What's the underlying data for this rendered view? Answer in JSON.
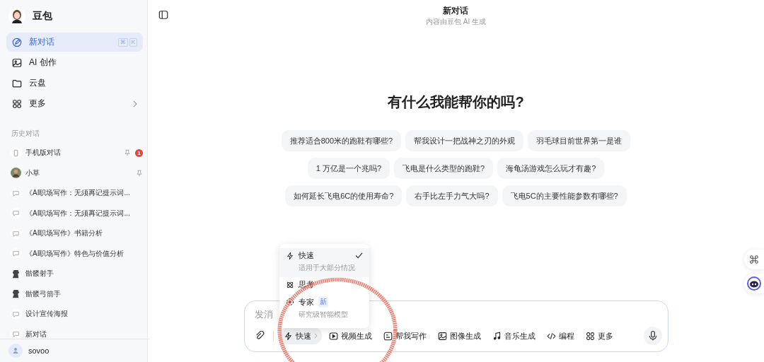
{
  "sidebar": {
    "app_name": "豆包",
    "nav": [
      {
        "label": "新对话",
        "kind": "edit",
        "selected": true,
        "keys": [
          "⌘",
          "K"
        ]
      },
      {
        "label": "AI 创作",
        "kind": "image",
        "selected": false
      },
      {
        "label": "云盘",
        "kind": "folder",
        "selected": false
      },
      {
        "label": "更多",
        "kind": "grid",
        "selected": false,
        "chevron": true
      }
    ],
    "history_label": "历史对话",
    "history": [
      {
        "title": "手机版对话",
        "kind": "phone",
        "pinned": true,
        "badge": "1"
      },
      {
        "title": "小草",
        "kind": "avatar",
        "pinned": true
      },
      {
        "title": "《AI职场写作：无须再记提示词...",
        "kind": "chat",
        "pinned": false
      },
      {
        "title": "《AI职场写作：无须再记提示词...",
        "kind": "chat",
        "pinned": false
      },
      {
        "title": "《AI职场写作》书籍分析",
        "kind": "chat",
        "pinned": false
      },
      {
        "title": "《AI职场写作》特色与价值分析",
        "kind": "chat",
        "pinned": false
      },
      {
        "title": "骷髅射手",
        "kind": "figure",
        "pinned": false
      },
      {
        "title": "骷髅弓箭手",
        "kind": "figure",
        "pinned": false
      },
      {
        "title": "设计宣传海报",
        "kind": "chat",
        "pinned": false
      },
      {
        "title": "新对话",
        "kind": "chat",
        "pinned": false
      }
    ],
    "user": "sovoo"
  },
  "header": {
    "title": "新对话",
    "subtitle": "内容由豆包 AI 生成"
  },
  "heading": "有什么我能帮你的吗?",
  "suggestions": [
    [
      "推荐适合800米的跑鞋有哪些?",
      "帮我设计一把战神之刃的外观",
      "羽毛球目前世界第一是谁"
    ],
    [
      "1 万亿是一个兆吗?",
      "飞电是什么类型的跑鞋?",
      "海龟汤游戏怎么玩才有趣?"
    ],
    [
      "如何延长飞电6C的使用寿命?",
      "右手比左手力气大吗?",
      "飞电5C的主要性能参数有哪些?"
    ]
  ],
  "mode_menu": [
    {
      "label": "快速",
      "kind": "bolt",
      "description": "适用于大部分情况",
      "selected": true
    },
    {
      "label": "思考",
      "kind": "atom",
      "selected": false
    },
    {
      "label": "专家",
      "kind": "dots",
      "description": "研究级智能模型",
      "badge": "新",
      "selected": false
    }
  ],
  "input": {
    "placeholder": "发消",
    "tools": [
      {
        "label": "快速",
        "kind": "bolt",
        "selected": true
      },
      {
        "label": "视频生成",
        "kind": "video",
        "selected": false
      },
      {
        "label": "帮我写作",
        "kind": "write",
        "selected": false
      },
      {
        "label": "图像生成",
        "kind": "image",
        "selected": false
      },
      {
        "label": "音乐生成",
        "kind": "music",
        "selected": false
      },
      {
        "label": "编程",
        "kind": "code",
        "selected": false
      },
      {
        "label": "更多",
        "kind": "grid",
        "selected": false
      }
    ]
  }
}
